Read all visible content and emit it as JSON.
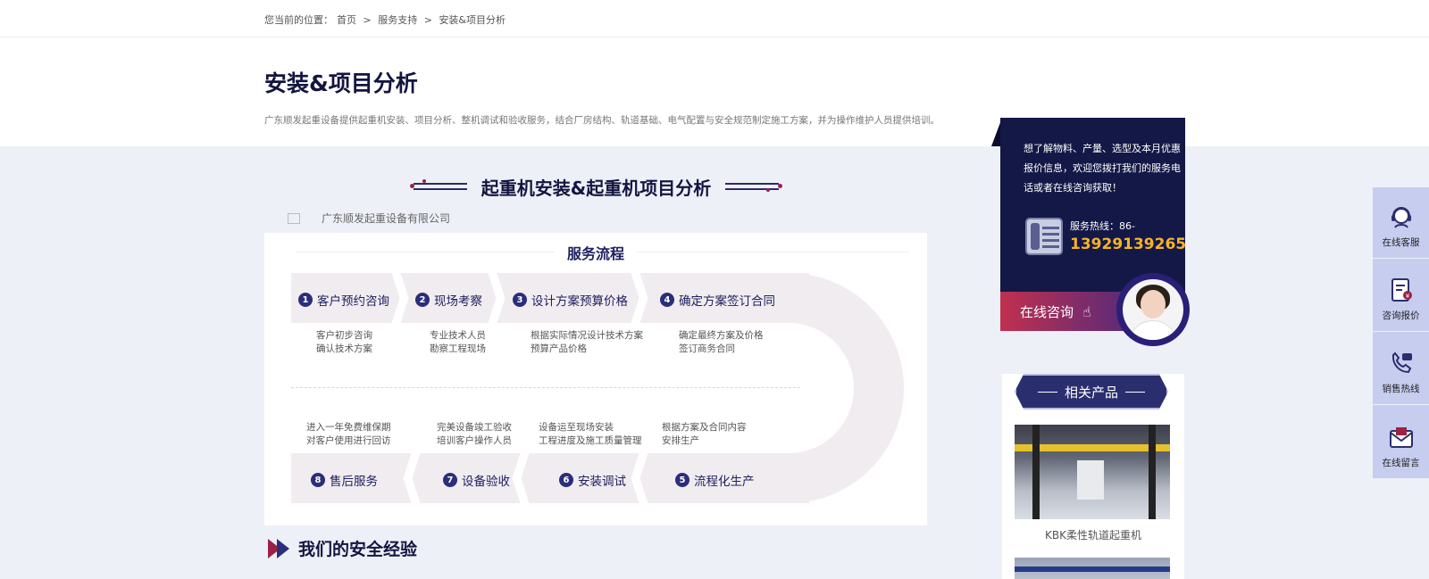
{
  "breadcrumb": {
    "prefix": "您当前的位置：",
    "items": [
      "首页",
      "服务支持",
      "安装&项目分析"
    ],
    "separator": ">"
  },
  "hero": {
    "title": "安装&项目分析",
    "description": "广东顺发起重设备提供起重机安装、项目分析、整机调试和验收服务，结合厂房结构、轨道基础、电气配置与安全规范制定施工方案，并为操作维护人员提供培训。"
  },
  "section": {
    "title": "起重机安装&起重机项目分析",
    "image_alt": "广东顺发起重设备有限公司"
  },
  "flow": {
    "title": "服务流程",
    "top_steps": [
      {
        "num": "1",
        "label": "客户预约咨询",
        "desc": [
          "客户初步咨询",
          "确认技术方案"
        ]
      },
      {
        "num": "2",
        "label": "现场考察",
        "desc": [
          "专业技术人员",
          "勘察工程现场"
        ]
      },
      {
        "num": "3",
        "label": "设计方案预算价格",
        "desc": [
          "根据实际情况设计技术方案",
          "预算产品价格"
        ]
      },
      {
        "num": "4",
        "label": "确定方案签订合同",
        "desc": [
          "确定最终方案及价格",
          "签订商务合同"
        ]
      }
    ],
    "bottom_steps": [
      {
        "num": "8",
        "label": "售后服务",
        "desc": [
          "进入一年免费维保期",
          "对客户使用进行回访"
        ]
      },
      {
        "num": "7",
        "label": "设备验收",
        "desc": [
          "完美设备竣工验收",
          "培训客户操作人员"
        ]
      },
      {
        "num": "6",
        "label": "安装调试",
        "desc": [
          "设备运至现场安装",
          "工程进度及施工质量管理"
        ]
      },
      {
        "num": "5",
        "label": "流程化生产",
        "desc": [
          "根据方案及合同内容",
          "安排生产"
        ]
      }
    ]
  },
  "experience": {
    "title": "我们的安全经验"
  },
  "consult": {
    "text": "想了解物料、产量、选型及本月优惠报价信息，欢迎您拨打我们的服务电话或者在线咨询获取！",
    "hotline_label": "服务热线：86-",
    "hotline_number": "13929139265",
    "button_label": "在线咨询",
    "hand_icon": "☝"
  },
  "related": {
    "title": "相关产品",
    "products": [
      {
        "name": "KBK柔性轨道起重机"
      }
    ]
  },
  "side_tools": [
    {
      "label": "在线客服",
      "icon": "headset-icon"
    },
    {
      "label": "咨询报价",
      "icon": "quote-icon"
    },
    {
      "label": "销售热线",
      "icon": "phone-icon"
    },
    {
      "label": "在线留言",
      "icon": "mail-icon"
    }
  ],
  "colors": {
    "navy": "#131540",
    "accent_red": "#9b2245",
    "hotline_yellow": "#f5b326",
    "side_bar": "#c7cdef"
  }
}
